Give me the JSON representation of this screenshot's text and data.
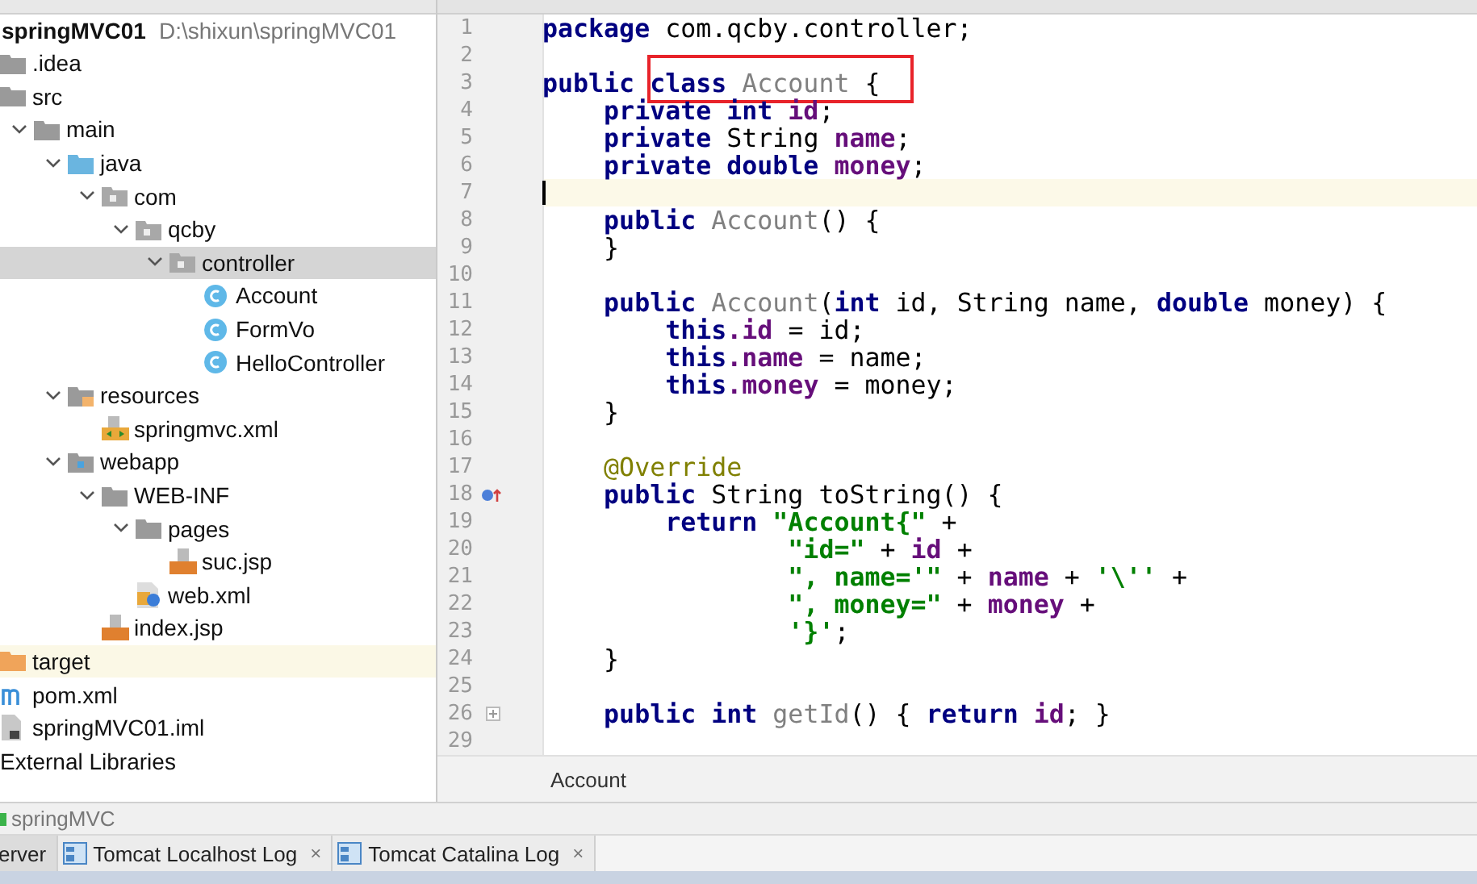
{
  "project": {
    "name": "springMVC01",
    "path": "D:\\shixun\\springMVC01"
  },
  "tree": [
    {
      "label": ".idea",
      "kind": "folder",
      "selected": false
    },
    {
      "label": "src",
      "kind": "folder",
      "selected": false,
      "children": [
        {
          "label": "main",
          "kind": "folder",
          "expanded": true,
          "selected": false,
          "children": [
            {
              "label": "java",
              "kind": "source-folder",
              "expanded": true,
              "selected": false,
              "children": [
                {
                  "label": "com",
                  "kind": "package",
                  "expanded": true,
                  "selected": false,
                  "children": [
                    {
                      "label": "qcby",
                      "kind": "package",
                      "expanded": true,
                      "selected": false,
                      "children": [
                        {
                          "label": "controller",
                          "kind": "package",
                          "expanded": true,
                          "selected": true,
                          "children": [
                            {
                              "label": "Account",
                              "kind": "class",
                              "selected": false
                            },
                            {
                              "label": "FormVo",
                              "kind": "class",
                              "selected": false
                            },
                            {
                              "label": "HelloController",
                              "kind": "class",
                              "selected": false
                            }
                          ]
                        }
                      ]
                    }
                  ]
                }
              ]
            },
            {
              "label": "resources",
              "kind": "resource-folder",
              "expanded": true,
              "selected": false,
              "children": [
                {
                  "label": "springmvc.xml",
                  "kind": "xml",
                  "selected": false
                }
              ]
            },
            {
              "label": "webapp",
              "kind": "web-folder",
              "expanded": true,
              "selected": false,
              "children": [
                {
                  "label": "WEB-INF",
                  "kind": "folder",
                  "expanded": true,
                  "selected": false,
                  "children": [
                    {
                      "label": "pages",
                      "kind": "folder",
                      "expanded": true,
                      "selected": false,
                      "children": [
                        {
                          "label": "suc.jsp",
                          "kind": "jsp",
                          "selected": false
                        }
                      ]
                    },
                    {
                      "label": "web.xml",
                      "kind": "webxml",
                      "selected": false
                    }
                  ]
                },
                {
                  "label": "index.jsp",
                  "kind": "jsp",
                  "selected": false
                }
              ]
            }
          ]
        }
      ]
    },
    {
      "label": "target",
      "kind": "excluded-folder",
      "selected": false
    },
    {
      "label": "pom.xml",
      "kind": "maven",
      "selected": false
    },
    {
      "label": "springMVC01.iml",
      "kind": "iml",
      "selected": false
    },
    {
      "label": "External Libraries",
      "kind": "library",
      "selected": false
    }
  ],
  "editor": {
    "lines": [
      {
        "number": "1",
        "kind": "code",
        "tokens": [
          {
            "kind": "keyword",
            "text": "package"
          },
          {
            "kind": "plain",
            "text": " com.qcby.controller;"
          }
        ]
      },
      {
        "number": "2",
        "kind": "code"
      },
      {
        "number": "3",
        "kind": "code",
        "boxed": true,
        "tokens": [
          {
            "kind": "keyword",
            "text": "public class "
          },
          {
            "kind": "unused",
            "text": "Account"
          },
          {
            "kind": "plain",
            "text": " {"
          }
        ]
      },
      {
        "number": "4",
        "kind": "code",
        "tokens": [
          {
            "kind": "keyword",
            "text": "    private int "
          },
          {
            "kind": "field",
            "text": "id"
          },
          {
            "kind": "plain",
            "text": ";"
          }
        ]
      },
      {
        "number": "5",
        "kind": "code",
        "tokens": [
          {
            "kind": "keyword",
            "text": "    private"
          },
          {
            "kind": "plain",
            "text": " String "
          },
          {
            "kind": "field",
            "text": "name"
          },
          {
            "kind": "plain",
            "text": ";"
          }
        ]
      },
      {
        "number": "6",
        "kind": "code",
        "tokens": [
          {
            "kind": "keyword",
            "text": "    private double "
          },
          {
            "kind": "field",
            "text": "money"
          },
          {
            "kind": "plain",
            "text": ";"
          }
        ]
      },
      {
        "number": "7",
        "kind": "code",
        "caret": true
      },
      {
        "number": "8",
        "kind": "code",
        "tokens": [
          {
            "kind": "keyword",
            "text": "    public "
          },
          {
            "kind": "unused",
            "text": "Account"
          },
          {
            "kind": "plain",
            "text": "() {"
          }
        ]
      },
      {
        "number": "9",
        "kind": "code",
        "tokens": [
          {
            "kind": "plain",
            "text": "    }"
          }
        ]
      },
      {
        "number": "10",
        "kind": "code"
      },
      {
        "number": "11",
        "kind": "code",
        "tokens": [
          {
            "kind": "keyword",
            "text": "    public "
          },
          {
            "kind": "unused",
            "text": "Account"
          },
          {
            "kind": "plain",
            "text": "("
          },
          {
            "kind": "keyword",
            "text": "int"
          },
          {
            "kind": "plain",
            "text": " id, String name, "
          },
          {
            "kind": "keyword",
            "text": "double"
          },
          {
            "kind": "plain",
            "text": " money) {"
          }
        ]
      },
      {
        "number": "12",
        "kind": "code",
        "tokens": [
          {
            "kind": "keyword",
            "text": "        this"
          },
          {
            "kind": "field",
            "text": ".id"
          },
          {
            "kind": "plain",
            "text": " = id;"
          }
        ]
      },
      {
        "number": "13",
        "kind": "code",
        "tokens": [
          {
            "kind": "keyword",
            "text": "        this"
          },
          {
            "kind": "field",
            "text": ".name"
          },
          {
            "kind": "plain",
            "text": " = name;"
          }
        ]
      },
      {
        "number": "14",
        "kind": "code",
        "tokens": [
          {
            "kind": "keyword",
            "text": "        this"
          },
          {
            "kind": "field",
            "text": ".money"
          },
          {
            "kind": "plain",
            "text": " = money;"
          }
        ]
      },
      {
        "number": "15",
        "kind": "code",
        "tokens": [
          {
            "kind": "plain",
            "text": "    }"
          }
        ]
      },
      {
        "number": "16",
        "kind": "code"
      },
      {
        "number": "17",
        "kind": "code",
        "tokens": [
          {
            "kind": "annotation",
            "text": "    @Override"
          }
        ]
      },
      {
        "number": "18",
        "kind": "override",
        "tokens": [
          {
            "kind": "keyword",
            "text": "    public"
          },
          {
            "kind": "plain",
            "text": " String toString() {"
          }
        ]
      },
      {
        "number": "19",
        "kind": "code",
        "tokens": [
          {
            "kind": "keyword",
            "text": "        return "
          },
          {
            "kind": "string",
            "text": "\"Account{\""
          },
          {
            "kind": "plain",
            "text": " +"
          }
        ]
      },
      {
        "number": "20",
        "kind": "code",
        "tokens": [
          {
            "kind": "string",
            "text": "                \"id=\""
          },
          {
            "kind": "plain",
            "text": " + "
          },
          {
            "kind": "field",
            "text": "id"
          },
          {
            "kind": "plain",
            "text": " +"
          }
        ]
      },
      {
        "number": "21",
        "kind": "code",
        "tokens": [
          {
            "kind": "string",
            "text": "                \", name='\""
          },
          {
            "kind": "plain",
            "text": " + "
          },
          {
            "kind": "field",
            "text": "name"
          },
          {
            "kind": "plain",
            "text": " + "
          },
          {
            "kind": "string",
            "text": "'\\''"
          },
          {
            "kind": "plain",
            "text": " +"
          }
        ]
      },
      {
        "number": "22",
        "kind": "code",
        "tokens": [
          {
            "kind": "string",
            "text": "                \", money=\""
          },
          {
            "kind": "plain",
            "text": " + "
          },
          {
            "kind": "field",
            "text": "money"
          },
          {
            "kind": "plain",
            "text": " +"
          }
        ]
      },
      {
        "number": "23",
        "kind": "code",
        "tokens": [
          {
            "kind": "string",
            "text": "                '}'"
          },
          {
            "kind": "plain",
            "text": ";"
          }
        ]
      },
      {
        "number": "24",
        "kind": "code",
        "tokens": [
          {
            "kind": "plain",
            "text": "    }"
          }
        ]
      },
      {
        "number": "25",
        "kind": "code"
      },
      {
        "number": "26",
        "kind": "fold",
        "tokens": [
          {
            "kind": "keyword",
            "text": "    public int "
          },
          {
            "kind": "unused",
            "text": "getId"
          },
          {
            "kind": "plain",
            "text": "() { "
          },
          {
            "kind": "keyword",
            "text": "return "
          },
          {
            "kind": "field",
            "text": "id"
          },
          {
            "kind": "plain",
            "text": "; }"
          }
        ]
      },
      {
        "number": "29",
        "kind": "code"
      }
    ],
    "breadcrumb": "Account"
  },
  "run_config": "springMVC",
  "bottom_tabs": [
    {
      "label": "erver",
      "kind": "plain",
      "selected": true
    },
    {
      "label": "Tomcat Localhost Log",
      "kind": "log",
      "selected": false,
      "close": "×"
    },
    {
      "label": "Tomcat Catalina Log",
      "kind": "log",
      "selected": false,
      "close": "×"
    }
  ]
}
